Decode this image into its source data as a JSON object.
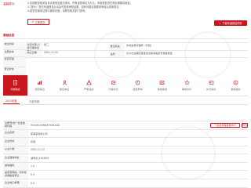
{
  "notice": {
    "label": "温馨提示：",
    "lines": [
      "2.定期报告相关信息请按规定格式填写，所有金额单位为万元，年度报告须在规定期限内披露。",
      "3.\"提示:\" 提交年度报告后请及时查看审核结果，如有问题请按要求修改后重新提交。",
      "4.若您在使用过程中遇到问题，请联系相关部门咨询。"
    ],
    "action_label": "立即提交"
  },
  "basic_info": {
    "section_title": "基础信息",
    "download_label": "下载年度报告附件",
    "left_labels": [
      "成立时间",
      "注册资本",
      "经营范围",
      "登记状态"
    ],
    "rows": [
      {
        "label": "法定代表人/执行事务合伙人",
        "value": "张三",
        "label2": "登记机关",
        "value2": "市场监督管理局（代码）"
      },
      {
        "label": "成立日期",
        "value": "2021-11-22",
        "label2": "住所",
        "value2": "长沙市岳麓区某某街道某某路某号某楼某室"
      }
    ]
  },
  "nav": {
    "items": [
      {
        "label": "年报信息",
        "icon": "report-icon",
        "active": true
      },
      {
        "label": "经营信息",
        "icon": "chart-icon",
        "active": false
      },
      {
        "label": "股东信息",
        "icon": "people-icon",
        "active": false
      },
      {
        "label": "严重违法",
        "icon": "alert-icon",
        "active": false
      },
      {
        "label": "行政处罚",
        "icon": "gavel-icon",
        "active": false
      },
      {
        "label": "经营异常",
        "icon": "warning-icon",
        "active": false
      },
      {
        "label": "信用承诺",
        "icon": "pledge-icon",
        "active": false
      },
      {
        "label": "信用评价",
        "icon": "star-icon",
        "active": false
      },
      {
        "label": "许可信息",
        "icon": "license-icon",
        "active": false
      },
      {
        "label": "其他信息",
        "icon": "info-icon",
        "active": false
      }
    ]
  },
  "tabs": {
    "items": [
      {
        "label": "2021年度",
        "active": true
      },
      {
        "label": "历史年报",
        "active": false
      }
    ]
  },
  "detail": {
    "title_label": "注册号/统一社会信用代码",
    "title_value": "91430100MA4TXXXXXX",
    "download_button": "下载此年度报告PDF",
    "preview_button": "预览",
    "rows": [
      {
        "label": "企业名称",
        "value": "某某某有限公司"
      },
      {
        "label": "企业状态",
        "value": "存续"
      },
      {
        "label": "从业人数",
        "value": "2021-11-22"
      },
      {
        "label": "企业通信地址",
        "value": "湖南长沙XXXXX"
      },
      {
        "label": "邮政编码",
        "value": "1.0"
      },
      {
        "label": "是否有网站、对外投资或股权转让",
        "value": "0.0"
      },
      {
        "label": "企业电子邮箱",
        "value": "0.0"
      }
    ]
  },
  "colors": {
    "accent": "#c8161e",
    "label_bg": "#f7f7f7",
    "border": "#e6e6e6"
  }
}
